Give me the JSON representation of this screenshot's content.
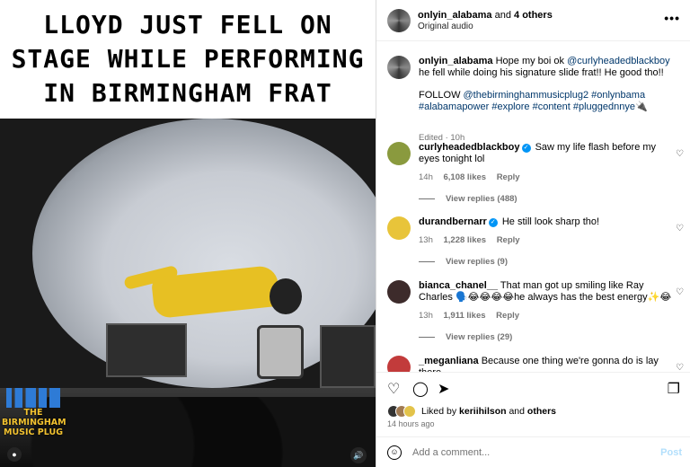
{
  "media": {
    "caption_lines": [
      "LLOYD JUST FELL ON",
      "STAGE WHILE PERFORMING",
      "IN BIRMINGHAM FRAT"
    ],
    "watermark_text": "THE BIRMINGHAM MUSIC PLUG"
  },
  "header": {
    "username": "onlyin_alabama",
    "joiner": "and",
    "others": "4 others",
    "audio": "Original audio",
    "more_icon": "more-horizontal-icon"
  },
  "caption": {
    "username": "onlyin_alabama",
    "text_before": "Hope my boi ok ",
    "mention": "@curlyheadedblackboy",
    "text_after": " he fell while doing his signature slide frat!! He good tho!!",
    "follow_prefix": "FOLLOW ",
    "follow_link": "@thebirminghammusicplug2",
    "hashtags": " #onlynbama #alabamapower #explore #content #pluggednnye",
    "plug_emoji": "🔌",
    "edited": "Edited · 10h"
  },
  "comments": [
    {
      "username": "curlyheadedblackboy",
      "verified": true,
      "text": "Saw my life flash before my eyes tonight lol",
      "time": "14h",
      "likes": "6,108 likes",
      "reply": "Reply",
      "view_replies": "View replies (488)",
      "avatar_color": "#8a9a3e"
    },
    {
      "username": "durandbernarr",
      "verified": true,
      "text": "He still look sharp tho!",
      "time": "13h",
      "likes": "1,228 likes",
      "reply": "Reply",
      "view_replies": "View replies (9)",
      "avatar_color": "#e8c43a"
    },
    {
      "username": "bianca_chanel__",
      "verified": false,
      "text": "That man got up smiling like Ray Charles 🗣️😂😂😂😂he always has the best energy✨😂",
      "time": "13h",
      "likes": "1,911 likes",
      "reply": "Reply",
      "view_replies": "View replies (29)",
      "avatar_color": "#3d2b2b"
    },
    {
      "username": "_meganliana",
      "verified": false,
      "text": "Because one thing we're gonna do is lay there",
      "avatar_color": "#c23b3b"
    }
  ],
  "actions": {
    "like_icon": "heart-icon",
    "comment_icon": "comment-icon",
    "share_icon": "paper-plane-icon",
    "save_icon": "bookmark-icon",
    "liked_prefix": "Liked by ",
    "liked_user": "keriihilson",
    "liked_joiner": " and ",
    "liked_others": "others",
    "posted_ago": "14 hours ago"
  },
  "comment_box": {
    "placeholder": "Add a comment...",
    "post_label": "Post"
  },
  "colors": {
    "verified": "#0095f6",
    "link": "#00376b",
    "muted": "#737373",
    "post_button": "#b2dffc"
  }
}
